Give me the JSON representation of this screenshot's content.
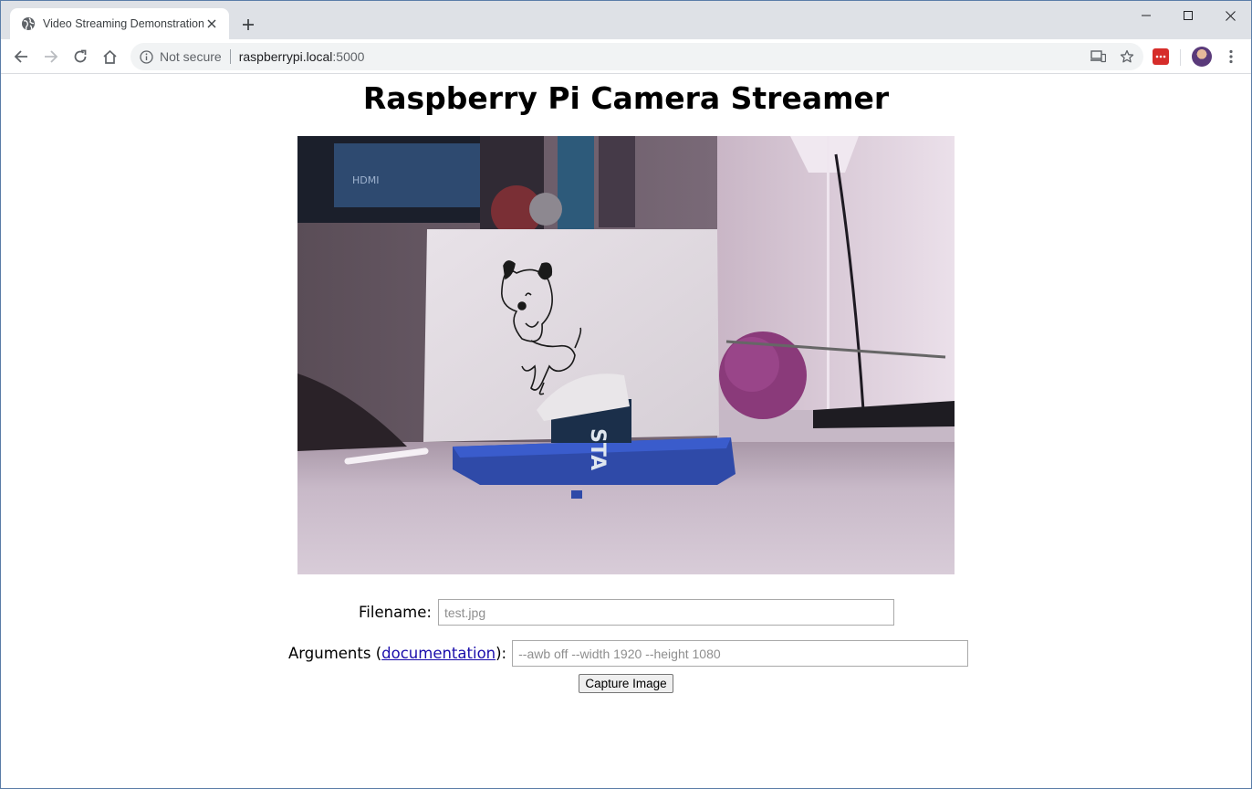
{
  "browser": {
    "tab_title": "Video Streaming Demonstration",
    "tab_favicon": "globe-icon",
    "url_security": "Not secure",
    "url_host": "raspberrypi.local",
    "url_port": ":5000",
    "colors": {
      "tabstrip": "#dee1e6",
      "omnibox": "#f1f3f4",
      "extension": "#d62d2a",
      "link": "#1a0dab"
    }
  },
  "page": {
    "heading": "Raspberry Pi Camera Streamer",
    "stream_alt": "live camera stream",
    "filename_label": "Filename:",
    "filename_placeholder": "test.jpg",
    "arguments_label_prefix": "Arguments (",
    "arguments_link": "documentation",
    "arguments_label_suffix": "):",
    "arguments_placeholder": "--awb off --width 1920 --height 1080",
    "capture_button": "Capture Image"
  }
}
